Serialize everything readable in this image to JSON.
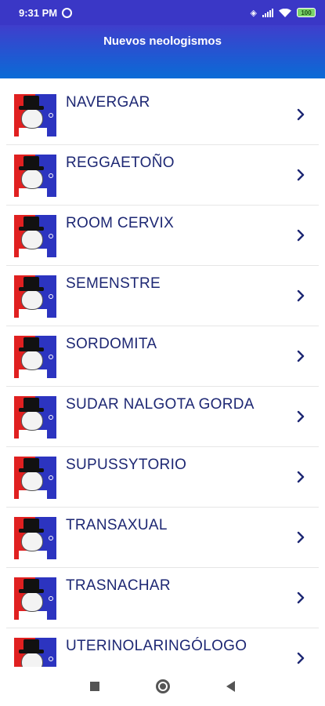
{
  "status_bar": {
    "time": "9:31 PM",
    "battery": "100"
  },
  "app_bar": {
    "title": "Nuevos neologismos"
  },
  "list": {
    "items": [
      {
        "label": "NAVERGAR"
      },
      {
        "label": "REGGAETOÑO"
      },
      {
        "label": "ROOM CERVIX"
      },
      {
        "label": "SEMENSTRE"
      },
      {
        "label": "SORDOMITA"
      },
      {
        "label": "SUDAR NALGOTA GORDA"
      },
      {
        "label": "SUPUSSYTORIO"
      },
      {
        "label": "TRANSAXUAL"
      },
      {
        "label": "TRASNACHAR"
      },
      {
        "label": "UTERINOLARINGÓLOGO"
      }
    ]
  },
  "icons": {
    "row_thumbnail": "meme-face-top-hat-icon",
    "row_chevron": "chevron-right-icon",
    "nav_recents": "square-recents-icon",
    "nav_home": "circle-home-icon",
    "nav_back": "triangle-back-icon"
  },
  "colors": {
    "status_bar": "#3a37c6",
    "app_bar_top": "#3f3ecc",
    "app_bar_bottom": "#0a6bd6",
    "label_text": "#1d2773",
    "thumb_red": "#e02020",
    "thumb_blue": "#2c34c0"
  }
}
